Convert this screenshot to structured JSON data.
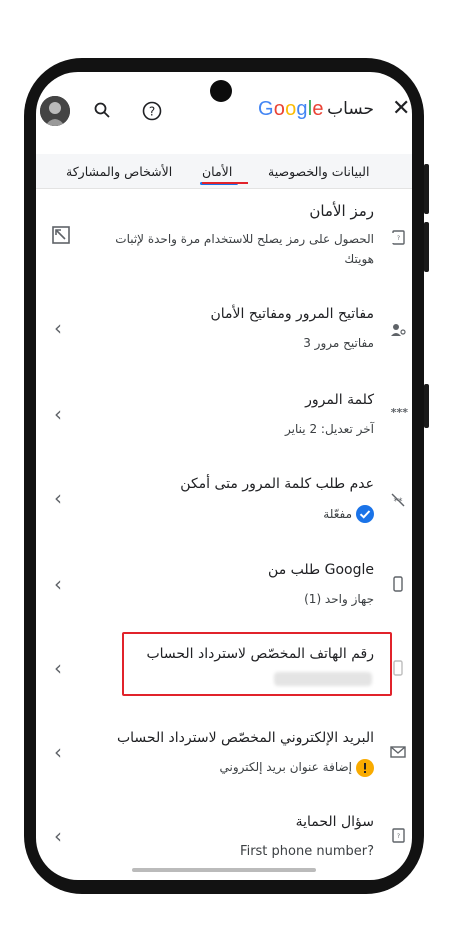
{
  "header": {
    "title": "حساب",
    "brand": "Google",
    "close_icon": "close-icon",
    "help_icon": "help-icon",
    "search_icon": "search-icon"
  },
  "tabs": [
    {
      "label": "البيانات والخصوصية",
      "active": false
    },
    {
      "label": "الأمان",
      "active": true
    },
    {
      "label": "الأشخاص والمشاركة",
      "active": false
    }
  ],
  "rows": [
    {
      "title": "رمز الأمان",
      "subtitle_line1": "الحصول على رمز يصلح للاستخدام مرة واحدة لإثبات",
      "subtitle_line2": "هويتك"
    },
    {
      "title": "مفاتيح المرور ومفاتيح الأمان",
      "subtitle": "3 مفاتيح مرور"
    },
    {
      "title": "كلمة المرور",
      "subtitle": "آخر تعديل: 2 يناير",
      "icon_text": "***"
    },
    {
      "title": "عدم طلب كلمة المرور متى أمكن",
      "subtitle": "مفعّلة"
    },
    {
      "title": "طلب من Google",
      "subtitle": "جهاز واحد (1)"
    },
    {
      "title": "رقم الهاتف المخصّص لاسترداد الحساب"
    },
    {
      "title": "البريد الإلكتروني المخصّص لاسترداد الحساب",
      "subtitle": "إضافة عنوان بريد إلكتروني"
    },
    {
      "title": "سؤال الحماية",
      "subtitle": "First phone number?"
    }
  ],
  "colors": {
    "accent": "#1a73e8",
    "highlight": "#e1232b",
    "warning": "#f9ab00"
  }
}
